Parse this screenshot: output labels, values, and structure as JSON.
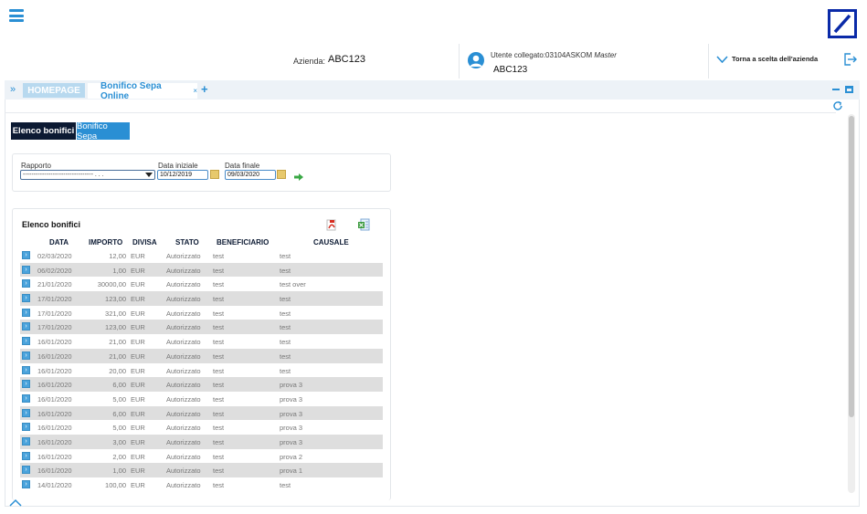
{
  "header": {
    "azienda_label": "Azienda:",
    "azienda_value": "ABC123",
    "user_label": "Utente collegato:03104ASKOM",
    "user_role": "Master",
    "user_value": "ABC123",
    "torna_label": "Torna a scelta dell'azienda"
  },
  "tabs": {
    "home_label": "HOMEPAGE",
    "active_label": "Bonifico Sepa Online",
    "close_glyph": "×",
    "add_glyph": "+",
    "toggle_glyph": "»"
  },
  "subtabs": {
    "elenco": "Elenco bonifici",
    "sepa": "Bonifico Sepa"
  },
  "filter": {
    "rapporto_label": "Rapporto",
    "rapporto_value": "--------------------------------- . . .",
    "data_iniziale_label": "Data iniziale",
    "data_iniziale_value": "10/12/2019",
    "data_finale_label": "Data finale",
    "data_finale_value": "09/03/2020"
  },
  "results": {
    "title": "Elenco bonifici",
    "columns": [
      "DATA",
      "IMPORTO",
      "DIVISA",
      "STATO",
      "BENEFICIARIO",
      "CAUSALE"
    ],
    "rows": [
      {
        "data": "02/03/2020",
        "importo": "12,00",
        "divisa": "EUR",
        "stato": "Autorizzato",
        "beneficiario": "test",
        "causale": "test"
      },
      {
        "data": "06/02/2020",
        "importo": "1,00",
        "divisa": "EUR",
        "stato": "Autorizzato",
        "beneficiario": "test",
        "causale": "test"
      },
      {
        "data": "21/01/2020",
        "importo": "30000,00",
        "divisa": "EUR",
        "stato": "Autorizzato",
        "beneficiario": "test",
        "causale": "test over"
      },
      {
        "data": "17/01/2020",
        "importo": "123,00",
        "divisa": "EUR",
        "stato": "Autorizzato",
        "beneficiario": "test",
        "causale": "test"
      },
      {
        "data": "17/01/2020",
        "importo": "321,00",
        "divisa": "EUR",
        "stato": "Autorizzato",
        "beneficiario": "test",
        "causale": "test"
      },
      {
        "data": "17/01/2020",
        "importo": "123,00",
        "divisa": "EUR",
        "stato": "Autorizzato",
        "beneficiario": "test",
        "causale": "test"
      },
      {
        "data": "16/01/2020",
        "importo": "21,00",
        "divisa": "EUR",
        "stato": "Autorizzato",
        "beneficiario": "test",
        "causale": "test"
      },
      {
        "data": "16/01/2020",
        "importo": "21,00",
        "divisa": "EUR",
        "stato": "Autorizzato",
        "beneficiario": "test",
        "causale": "test"
      },
      {
        "data": "16/01/2020",
        "importo": "20,00",
        "divisa": "EUR",
        "stato": "Autorizzato",
        "beneficiario": "test",
        "causale": "test"
      },
      {
        "data": "16/01/2020",
        "importo": "6,00",
        "divisa": "EUR",
        "stato": "Autorizzato",
        "beneficiario": "test",
        "causale": "prova 3"
      },
      {
        "data": "16/01/2020",
        "importo": "5,00",
        "divisa": "EUR",
        "stato": "Autorizzato",
        "beneficiario": "test",
        "causale": "prova 3"
      },
      {
        "data": "16/01/2020",
        "importo": "6,00",
        "divisa": "EUR",
        "stato": "Autorizzato",
        "beneficiario": "test",
        "causale": "prova 3"
      },
      {
        "data": "16/01/2020",
        "importo": "5,00",
        "divisa": "EUR",
        "stato": "Autorizzato",
        "beneficiario": "test",
        "causale": "prova 3"
      },
      {
        "data": "16/01/2020",
        "importo": "3,00",
        "divisa": "EUR",
        "stato": "Autorizzato",
        "beneficiario": "test",
        "causale": "prova 3"
      },
      {
        "data": "16/01/2020",
        "importo": "2,00",
        "divisa": "EUR",
        "stato": "Autorizzato",
        "beneficiario": "test",
        "causale": "prova 2"
      },
      {
        "data": "16/01/2020",
        "importo": "1,00",
        "divisa": "EUR",
        "stato": "Autorizzato",
        "beneficiario": "test",
        "causale": "prova 1"
      },
      {
        "data": "14/01/2020",
        "importo": "100,00",
        "divisa": "EUR",
        "stato": "Autorizzato",
        "beneficiario": "test",
        "causale": "test"
      }
    ]
  },
  "icons": {
    "menu": "hamburger-icon",
    "logo": "deutsche-bank-logo",
    "user": "user-icon",
    "torna": "chevron-down-icon",
    "logout": "logout-icon",
    "minimize": "minimize-icon",
    "maximize": "maximize-icon",
    "refresh": "refresh-icon",
    "calendar": "calendar-icon",
    "go": "arrow-right-icon",
    "pdf": "pdf-icon",
    "xls": "excel-icon",
    "scroll_up": "chevron-up-icon"
  },
  "colors": {
    "accent": "#2a8fd4",
    "dark": "#0c1a33",
    "logo": "#0a2aa8",
    "row_alt": "#dedede"
  }
}
